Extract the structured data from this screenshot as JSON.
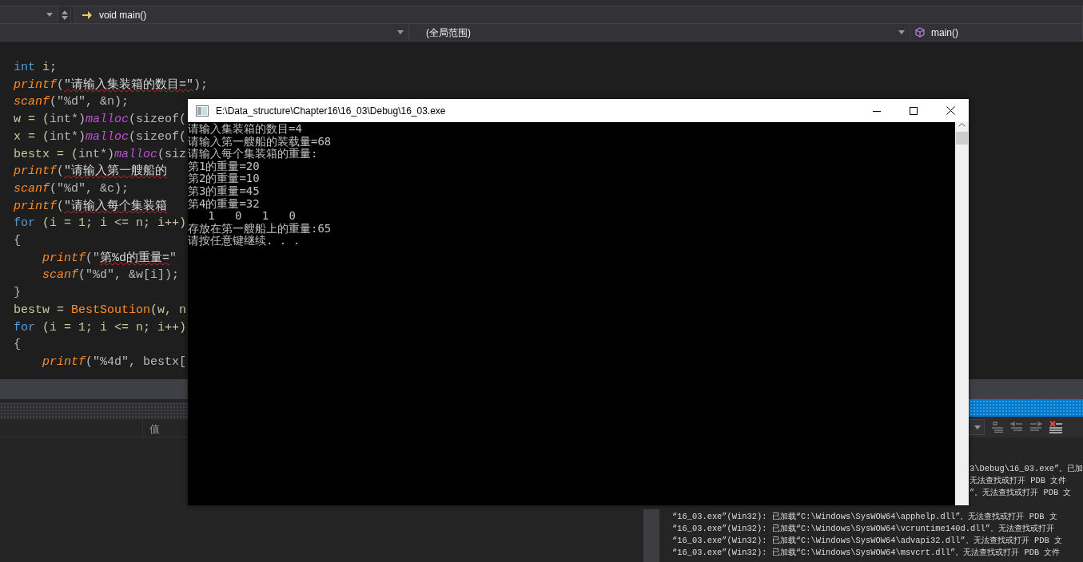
{
  "navigation_bar": {
    "function_field": "void main()",
    "scope_field": "(全局范围)",
    "member_field": "main()"
  },
  "editor": {
    "lines": [
      [
        {
          "text": "int",
          "kind": "keyword"
        },
        {
          "text": " i;",
          "kind": "identifier"
        }
      ],
      [
        {
          "text": "printf",
          "kind": "function"
        },
        {
          "text": "(",
          "kind": "punctuation"
        },
        {
          "text": "\"请输入集装箱的数目=\"",
          "kind": "flagged"
        },
        {
          "text": ");",
          "kind": "punctuation"
        }
      ],
      [
        {
          "text": "scanf",
          "kind": "function"
        },
        {
          "text": "(\"%d\", &n);",
          "kind": "punctuation"
        }
      ],
      [
        {
          "text": "w = (",
          "kind": "identifier"
        },
        {
          "text": "int*)",
          "kind": "punctuation"
        },
        {
          "text": "malloc",
          "kind": "macro"
        },
        {
          "text": "(sizeof(",
          "kind": "punctuation"
        }
      ],
      [
        {
          "text": "x = (",
          "kind": "identifier"
        },
        {
          "text": "int*)",
          "kind": "punctuation"
        },
        {
          "text": "malloc",
          "kind": "macro"
        },
        {
          "text": "(sizeof(",
          "kind": "punctuation"
        }
      ],
      [
        {
          "text": "bestx = (",
          "kind": "identifier"
        },
        {
          "text": "int*)",
          "kind": "punctuation"
        },
        {
          "text": "malloc",
          "kind": "macro"
        },
        {
          "text": "(siz",
          "kind": "punctuation"
        }
      ],
      [
        {
          "text": "printf",
          "kind": "function"
        },
        {
          "text": "(",
          "kind": "punctuation"
        },
        {
          "text": "\"请输入第一艘船的",
          "kind": "flagged"
        }
      ],
      [
        {
          "text": "scanf",
          "kind": "function"
        },
        {
          "text": "(\"%d\", &c);",
          "kind": "punctuation"
        }
      ],
      [
        {
          "text": "printf",
          "kind": "function"
        },
        {
          "text": "(",
          "kind": "punctuation"
        },
        {
          "text": "\"请输入每个集装箱",
          "kind": "flagged"
        }
      ],
      [
        {
          "text": "for",
          "kind": "keyword"
        },
        {
          "text": " (i = 1; i <= n; i++)",
          "kind": "identifier"
        }
      ],
      [
        {
          "text": "{",
          "kind": "punctuation"
        }
      ],
      [
        {
          "text": "    printf",
          "kind": "function"
        },
        {
          "text": "(\"",
          "kind": "punctuation"
        },
        {
          "text": "第%d的重量=",
          "kind": "flagged"
        },
        {
          "text": "\"",
          "kind": "punctuation"
        }
      ],
      [
        {
          "text": "    scanf",
          "kind": "function"
        },
        {
          "text": "(\"%d\", &w[i]);",
          "kind": "punctuation"
        }
      ],
      [
        {
          "text": "}",
          "kind": "punctuation"
        }
      ],
      [
        {
          "text": "bestw = ",
          "kind": "identifier"
        },
        {
          "text": "BestSoution",
          "kind": "call"
        },
        {
          "text": "(w, n",
          "kind": "identifier"
        }
      ],
      [
        {
          "text": "for",
          "kind": "keyword"
        },
        {
          "text": " (i = 1; i <= n; i++)",
          "kind": "identifier"
        }
      ],
      [
        {
          "text": "{",
          "kind": "punctuation"
        }
      ],
      [
        {
          "text": "    printf",
          "kind": "function"
        },
        {
          "text": "(\"%4d\", bestx[",
          "kind": "punctuation"
        }
      ]
    ]
  },
  "watch_panel": {
    "columns": [
      "值"
    ]
  },
  "output_panel": {
    "lines": [
      {
        "text": "3\\Debug\\16_03.exe”。已加",
        "kind": "clipped"
      },
      {
        "text": "无法查找或打开 PDB 文件",
        "kind": "clipped"
      },
      {
        "text": "”。无法查找或打开 PDB 文",
        "kind": "clipped"
      },
      {
        "text": "“16_03.exe”(Win32): 已加载“C:\\Windows\\SysWOW64\\apphelp.dll”。无法查找或打开 PDB 文",
        "kind": "full"
      },
      {
        "text": "“16_03.exe”(Win32): 已加载“C:\\Windows\\SysWOW64\\vcruntime140d.dll”。无法查找或打开",
        "kind": "full"
      },
      {
        "text": "“16_03.exe”(Win32): 已加载“C:\\Windows\\SysWOW64\\advapi32.dll”。无法查找或打开 PDB 文",
        "kind": "full"
      },
      {
        "text": "“16_03.exe”(Win32): 已加载“C:\\Windows\\SysWOW64\\msvcrt.dll”。无法查找或打开 PDB 文件",
        "kind": "full"
      }
    ]
  },
  "console": {
    "title": "E:\\Data_structure\\Chapter16\\16_03\\Debug\\16_03.exe",
    "lines": [
      "请输入集装箱的数目=4",
      "请输入第一艘船的装载量=68",
      "请输入每个集装箱的重量:",
      "第1的重量=20",
      "第2的重量=10",
      "第3的重量=45",
      "第4的重量=32",
      "   1   0   1   0",
      "存放在第一艘船上的重量:65",
      "请按任意键继续. . ."
    ]
  }
}
